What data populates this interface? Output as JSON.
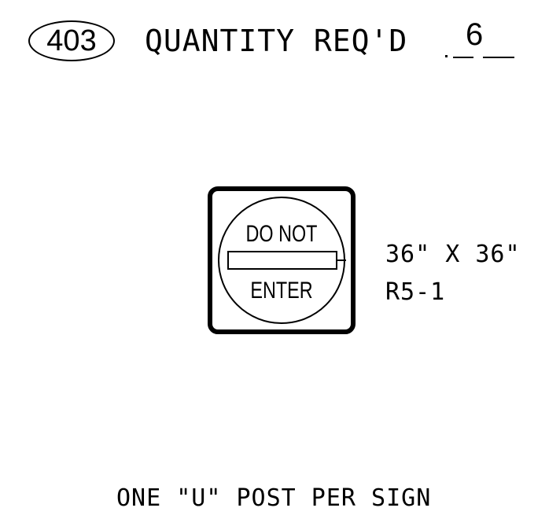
{
  "header": {
    "sheet_number": "403",
    "quantity_label": "QUANTITY REQ'D",
    "quantity_value": "6"
  },
  "sign": {
    "legend_top": "DO NOT",
    "legend_bottom": "ENTER",
    "size": "36\" X 36\"",
    "code": "R5-1"
  },
  "note": "ONE \"U\" POST PER SIGN"
}
